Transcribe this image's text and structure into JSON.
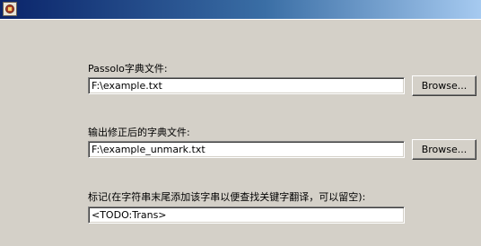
{
  "window": {
    "title": ""
  },
  "dictionary_field": {
    "label": "Passolo字典文件:",
    "value": "F:\\example.txt",
    "browse_label": "Browse..."
  },
  "output_field": {
    "label": "输出修正后的字典文件:",
    "value": "F:\\example_unmark.txt",
    "browse_label": "Browse..."
  },
  "marker_field": {
    "label": "标记(在字符串末尾添加该字串以便查找关键字翻译，可以留空):",
    "value": "<TODO:Trans>"
  },
  "colors": {
    "titlebar_start": "#0a246a",
    "titlebar_end": "#a6caf0",
    "window_background": "#d4d0c8"
  },
  "icons": {
    "app": "passolo-app-icon"
  }
}
